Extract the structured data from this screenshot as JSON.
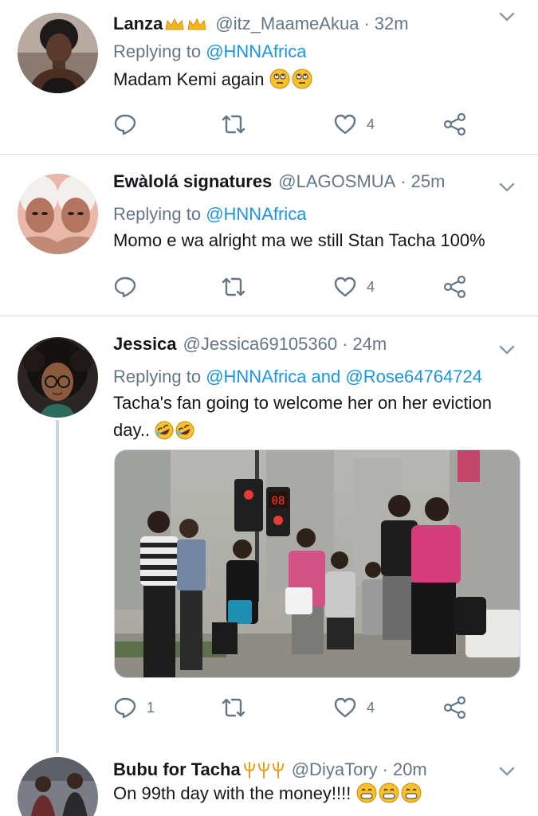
{
  "tweets": [
    {
      "name": "Lanza",
      "handle": "@itz_MaameAkua",
      "time": "32m",
      "reply_prefix": "Replying to",
      "reply_to": "@HNNAfrica",
      "text": "Madam Kemi again",
      "replies": "",
      "likes": "4"
    },
    {
      "name": "Ewàlolá signatures",
      "handle": "@LAGOSMUA",
      "time": "25m",
      "reply_prefix": "Replying to",
      "reply_to": "@HNNAfrica",
      "text": "Momo e wa alright ma we still Stan Tacha 100%",
      "replies": "",
      "likes": "4"
    },
    {
      "name": "Jessica",
      "handle": "@Jessica69105360",
      "time": "24m",
      "reply_prefix": "Replying to",
      "reply_to": "@HNNAfrica and @Rose64764724",
      "text": "Tacha's fan going to welcome her on her eviction day..",
      "replies": "1",
      "likes": "4",
      "image_sign_text": "08"
    },
    {
      "name": "Bubu for Tacha",
      "handle": "@DiyaTory",
      "time": "20m",
      "text": "On 99th day with the money!!!!"
    }
  ],
  "separator": "·",
  "icons": {
    "reply": "reply-icon",
    "retweet": "retweet-icon",
    "like": "like-icon",
    "share": "share-icon",
    "more": "chevron-down-icon"
  },
  "colors": {
    "link": "#1b95e0",
    "muted": "#657786",
    "divider": "#d9dde1"
  }
}
